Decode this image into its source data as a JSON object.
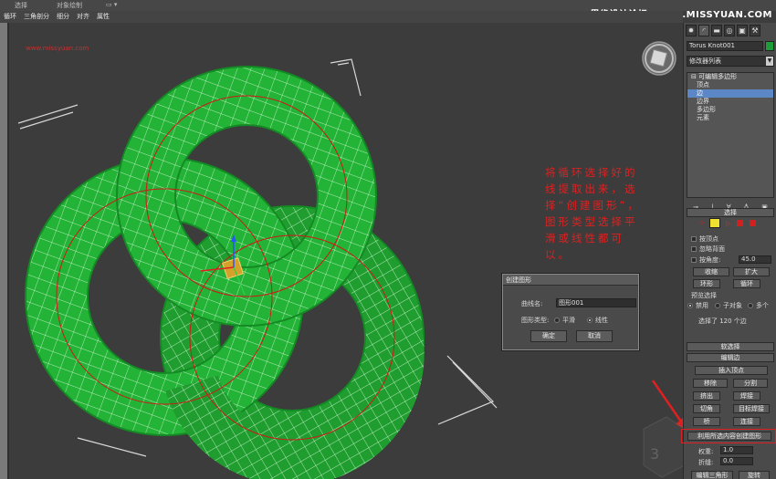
{
  "topbar": {
    "label_select": "选择",
    "label_object_paint": "对象绘制",
    "watermark": "思缘设计论坛 WWW.MISSYUAN.COM"
  },
  "menubar": {
    "items": [
      "循环",
      "三角剖分",
      "细分",
      "对齐",
      "属性"
    ]
  },
  "viewport": {
    "watermark_small": "www.missyuan.com",
    "annotation": "将循环选择好的线提取出来，选择“创建图形”，图形类型选择平滑或线性都可以。"
  },
  "dialog": {
    "title": "创建图形",
    "curve_name_label": "曲线名:",
    "curve_name_value": "图形001",
    "shape_type_label": "图形类型:",
    "option_smooth": "平滑",
    "option_linear": "线性",
    "ok_label": "确定",
    "cancel_label": "取消"
  },
  "panel": {
    "tabs": [
      "✹",
      "◜",
      "▬",
      "◎",
      "▣",
      "⚒"
    ],
    "object_name": "Torus Knot001",
    "object_color": "#1d9e3a",
    "modifier_list": "修改器列表",
    "stack": {
      "root": "可编辑多边形",
      "items": [
        "顶点",
        "边",
        "边界",
        "多边形",
        "元素"
      ],
      "selected_index": 1
    },
    "selection": {
      "title": "选择",
      "by_vertex": "按顶点",
      "ignore_backface": "忽略背面",
      "by_angle": "按角度:",
      "angle_value": "45.0",
      "shrink": "收缩",
      "grow": "扩大",
      "ring": "环形",
      "loop": "循环",
      "preview_title": "预览选择",
      "preview_off": "禁用",
      "preview_subobj": "子对象",
      "preview_multi": "多个",
      "status": "选择了 120 个边"
    },
    "soft_selection_title": "软选择",
    "edit_edges": {
      "title": "编辑边",
      "insert_vertex": "插入顶点",
      "remove": "移除",
      "split": "分割",
      "extrude": "挤出",
      "weld": "焊接",
      "chamfer": "切角",
      "target_weld": "目标焊接",
      "bridge": "桥",
      "connect": "连接",
      "create_shape": "利用所选内容创建图形",
      "weight_label": "权重:",
      "weight_value": "1.0",
      "crease_label": "折缝:",
      "crease_value": "0.0",
      "edit_tri": "编辑三角形",
      "turn": "旋转"
    }
  }
}
